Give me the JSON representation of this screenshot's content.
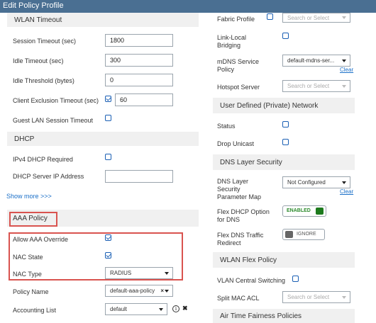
{
  "window": {
    "title": "Edit Policy Profile"
  },
  "left": {
    "wlan_timeout": {
      "header": "WLAN Timeout",
      "session_timeout": {
        "label": "Session Timeout (sec)",
        "value": "1800"
      },
      "idle_timeout": {
        "label": "Idle Timeout (sec)",
        "value": "300"
      },
      "idle_threshold": {
        "label": "Idle Threshold (bytes)",
        "value": "0"
      },
      "client_exclusion": {
        "label": "Client Exclusion Timeout (sec)",
        "checked": true,
        "value": "60"
      },
      "guest_lan": {
        "label": "Guest LAN Session Timeout",
        "checked": false
      }
    },
    "dhcp": {
      "header": "DHCP",
      "ipv4_required": {
        "label": "IPv4 DHCP Required",
        "checked": false
      },
      "server_ip": {
        "label": "DHCP Server IP Address",
        "value": ""
      },
      "show_more": "Show more >>>"
    },
    "aaa": {
      "header": "AAA Policy",
      "allow_override": {
        "label": "Allow AAA Override",
        "checked": true
      },
      "nac_state": {
        "label": "NAC State",
        "checked": true
      },
      "nac_type": {
        "label": "NAC Type",
        "value": "RADIUS"
      },
      "policy_name": {
        "label": "Policy Name",
        "value": "default-aaa-policy"
      },
      "accounting_list": {
        "label": "Accounting List",
        "value": "default"
      }
    }
  },
  "right": {
    "fabric_profile": {
      "label": "Fabric Profile",
      "checked": false,
      "placeholder": "Search or Select"
    },
    "link_local": {
      "label_line1": "Link-Local",
      "label_line2": "Bridging",
      "checked": false
    },
    "mdns": {
      "label_line1": "mDNS Service",
      "label_line2": "Policy",
      "value": "default-mdns-ser...",
      "clear": "Clear"
    },
    "hotspot": {
      "label": "Hotspot Server",
      "placeholder": "Search or Select"
    },
    "user_defined": {
      "header": "User Defined (Private) Network",
      "status": {
        "label": "Status",
        "checked": false
      },
      "drop_unicast": {
        "label": "Drop Unicast",
        "checked": false
      }
    },
    "dns_layer": {
      "header": "DNS Layer Security",
      "param_map": {
        "label_line1": "DNS Layer",
        "label_line2": "Security",
        "label_line3": "Parameter Map",
        "value": "Not Configured",
        "clear": "Clear"
      },
      "flex_dhcp": {
        "label_line1": "Flex DHCP Option",
        "label_line2": "for DNS",
        "toggle": "ENABLED"
      },
      "flex_dns": {
        "label_line1": "Flex DNS Traffic",
        "label_line2": "Redirect",
        "toggle": "IGNORE"
      }
    },
    "wlan_flex": {
      "header": "WLAN Flex Policy",
      "vlan_switching": {
        "label": "VLAN Central Switching",
        "checked": false
      },
      "split_mac": {
        "label": "Split MAC ACL",
        "placeholder": "Search or Select"
      }
    },
    "air_time": {
      "header": "Air Time Fairness Policies"
    }
  },
  "colors": {
    "titlebar": "#4a6f92",
    "highlight": "#d9534f",
    "link": "#1a6fc8",
    "enabled": "#1d7a1d"
  }
}
